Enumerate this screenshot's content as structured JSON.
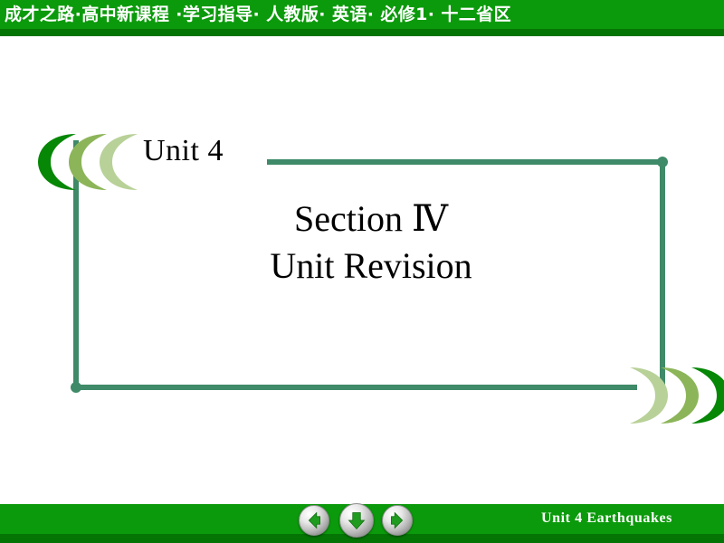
{
  "header": {
    "title": "成才之路·高中新课程 ·学习指导· 人教版· 英语· 必修1· 十二省区",
    "bar_color": "#0b9a0b",
    "shadow_color": "#047404"
  },
  "slide": {
    "unit_label": "Unit 4",
    "title_line1": "Section Ⅳ",
    "title_line2": "Unit Revision",
    "frame_color": "#3f8a68",
    "logo_colors": [
      "#068706",
      "#8cb559",
      "#b8d198"
    ]
  },
  "footer": {
    "label": "Unit  4   Earthquakes",
    "bar_color": "#0b9a0b",
    "shadow_color": "#047404",
    "nav": {
      "prev_label": "previous-slide",
      "down_label": "next-animation",
      "next_label": "next-slide",
      "arrow_color": "#1f9c1f"
    }
  }
}
